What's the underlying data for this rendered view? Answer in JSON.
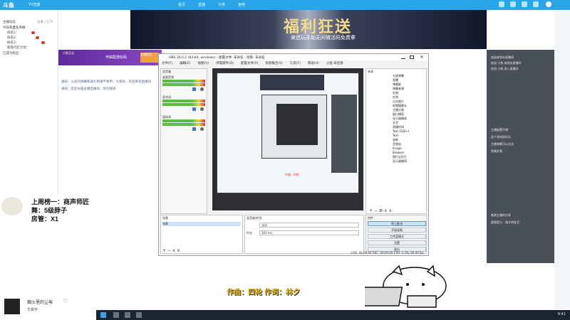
{
  "topbar": {
    "logo": "斗鱼",
    "title": "TV直播",
    "tabs": [
      "首页",
      "直播",
      "分类",
      "鱼吧"
    ]
  },
  "left_panel": {
    "header_left": "主播动态",
    "header_right": "设置 | 打卡",
    "rows": [
      "今日热度任务榜",
      "排名1",
      "排名2",
      "排名3",
      "超管闪灯计划",
      "已成为粉丝"
    ]
  },
  "banner": {
    "headline": "福利狂送",
    "subline": "来追玩永劫无间微活码免费拿"
  },
  "strip": {
    "left_label": "小鱼互动",
    "center_label": "作曲配游玩码",
    "badge": "主播推荐"
  },
  "main_lines": [
    "通知：以前的弹幕和送礼物请不要用，大家好，欢迎来到直播间",
    "通知：欢迎光临主播直播间，玩的愉快"
  ],
  "obs": {
    "title": "OBS 26.0.2 (64-bit, windows) - 配置文件: 未命名 - 场景: 未命名",
    "menu": [
      "文件(F)",
      "编辑(E)",
      "视图(V)",
      "停靠部件(D)",
      "配置文件(P)",
      "场景集合(S)",
      "工具(T)",
      "帮助(H)",
      "小鱼 未连接"
    ],
    "mixer_title": "混音器",
    "mixer_tracks": [
      "桌面音频",
      "麦克风",
      "媒体源"
    ],
    "preview_caption": "作曲 · 四轮",
    "sources_title": "来源",
    "sources": [
      "众星弹幕",
      "直播",
      "弹幕姬",
      "弹幕来源",
      "礼物",
      "在线",
      "点击图片",
      "前置摄像头",
      "主播头像",
      "窗口捕获",
      "显示器捕获",
      "文字",
      "直播时间",
      "Text (GDI+)",
      "Text",
      "录制",
      "音频轨",
      "Image",
      "Browser",
      "图片幻灯片",
      "显示器捕获"
    ],
    "scenes_title": "场景",
    "scenes": [
      "场景"
    ],
    "srcbox_title": "混音器/转场",
    "srcbox_field_1": "淡出",
    "srcbox_label_2": "时长",
    "srcbox_field_2": "300 ms",
    "controls_title": "控件",
    "controls": [
      "停止推流",
      "开始录制",
      "工作室模式",
      "设置",
      "退出"
    ],
    "status": "LIVE: 00:00:00   REC: 00:00:00   CPU: 2.3%, 60.00 fps"
  },
  "chat": {
    "lines": [
      "欢迎来到本直播间",
      "欢迎 小鱼 来到本直播间",
      "欢迎 小鱼 进入直播间",
      "主播配置不错",
      "这个游戏很好玩",
      "主播弹幕可以试试",
      "背景好看",
      "感谢主播的分享",
      "超管提示：请文明发言"
    ]
  },
  "rank": {
    "line1": "上周榜一：商声师匠",
    "line2": "舞：5级脖子",
    "line3": "房管：X1"
  },
  "credits": "作曲：四轮  作词：林夕",
  "bottom_left": {
    "song": "烟火里的尘埃",
    "artist": "华晨宇"
  },
  "taskbar": {
    "clock": "9:41"
  }
}
